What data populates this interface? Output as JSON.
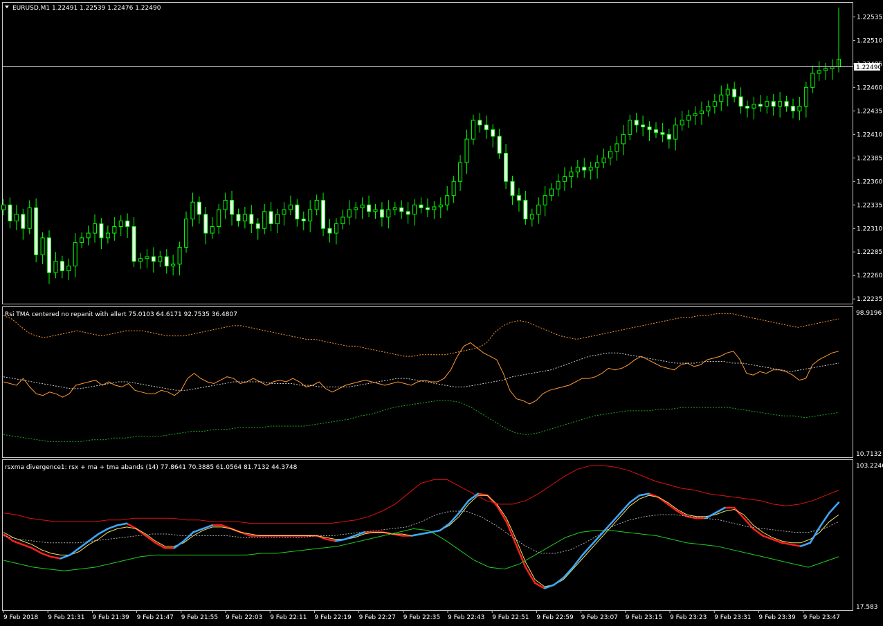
{
  "main": {
    "symbol_info": "EURUSD,M1  1.22491 1.22539 1.22476 1.22490",
    "current_price_label": "1.22490",
    "price_ticks": [
      "1.22535",
      "1.22510",
      "1.22485",
      "1.22460",
      "1.22435",
      "1.22410",
      "1.22385",
      "1.22360",
      "1.22335",
      "1.22310",
      "1.22285",
      "1.22260",
      "1.22235"
    ],
    "colors": {
      "bull": "#00ff00",
      "bull_body": "#000000",
      "bear_body": "#ffffff",
      "bg": "#000000"
    }
  },
  "rsi_panel": {
    "title": "Rsi TMA centered no repanit with allert 75.0103 64.6171 92.7535 36.4807",
    "top_label": "98.9196",
    "bottom_label": "10.7132"
  },
  "rsx_panel": {
    "title": "rsxma divergence1: rsx + ma + tma abands (14) 77.8641 70.3885 61.0564 81.7132 44.3748",
    "top_label": "103.2246",
    "bottom_label": "17.583"
  },
  "time_labels": [
    "9 Feb 2018",
    "9 Feb 21:31",
    "9 Feb 21:39",
    "9 Feb 21:47",
    "9 Feb 21:55",
    "9 Feb 22:03",
    "9 Feb 22:11",
    "9 Feb 22:19",
    "9 Feb 22:27",
    "9 Feb 22:35",
    "9 Feb 22:43",
    "9 Feb 22:51",
    "9 Feb 22:59",
    "9 Feb 23:07",
    "9 Feb 23:15",
    "9 Feb 23:23",
    "9 Feb 23:31",
    "9 Feb 23:39",
    "9 Feb 23:47"
  ],
  "chart_data": [
    {
      "type": "candlestick",
      "title": "EURUSD,M1  1.22491 1.22539 1.22476 1.22490",
      "ylim": [
        1.2223,
        1.2255
      ],
      "close": [
        1.22335,
        1.22318,
        1.22325,
        1.2231,
        1.22332,
        1.22282,
        1.223,
        1.22263,
        1.22275,
        1.22265,
        1.2227,
        1.22295,
        1.223,
        1.22305,
        1.22315,
        1.223,
        1.22305,
        1.22312,
        1.22318,
        1.22312,
        1.22275,
        1.22278,
        1.2228,
        1.22275,
        1.2228,
        1.2227,
        1.22272,
        1.2229,
        1.2232,
        1.22338,
        1.22325,
        1.22305,
        1.22312,
        1.2233,
        1.2234,
        1.22325,
        1.22318,
        1.22325,
        1.22315,
        1.2231,
        1.22328,
        1.22315,
        1.22325,
        1.2233,
        1.22335,
        1.2232,
        1.22318,
        1.2233,
        1.2234,
        1.2231,
        1.22305,
        1.22315,
        1.22322,
        1.2233,
        1.22332,
        1.22335,
        1.22328,
        1.2233,
        1.22322,
        1.2233,
        1.22332,
        1.22328,
        1.22325,
        1.22335,
        1.22332,
        1.2233,
        1.22333,
        1.22335,
        1.22345,
        1.2236,
        1.2238,
        1.22405,
        1.22425,
        1.2242,
        1.22415,
        1.22408,
        1.2239,
        1.2236,
        1.22345,
        1.2234,
        1.2232,
        1.22325,
        1.22335,
        1.22345,
        1.22352,
        1.2236,
        1.22365,
        1.2237,
        1.22375,
        1.22372,
        1.22375,
        1.2238,
        1.22385,
        1.22392,
        1.224,
        1.2241,
        1.22425,
        1.2242,
        1.22418,
        1.22415,
        1.22412,
        1.2241,
        1.22405,
        1.2242,
        1.22425,
        1.2243,
        1.22432,
        1.22435,
        1.2244,
        1.22445,
        1.22452,
        1.22458,
        1.2245,
        1.2244,
        1.22438,
        1.22442,
        1.2244,
        1.22445,
        1.2244,
        1.22445,
        1.2244,
        1.22435,
        1.2244,
        1.2246,
        1.22475,
        1.22478,
        1.2248,
        1.22482,
        1.2249
      ]
    },
    {
      "type": "line",
      "title": "Rsi TMA centered no repanit with allert 75.0103 64.6171 92.7535 36.4807",
      "ylim": [
        10.7132,
        98.9196
      ],
      "series": [
        {
          "values": [
            55,
            54,
            53,
            57,
            52,
            48,
            47,
            49,
            48,
            46,
            48,
            53,
            54,
            55,
            56,
            53,
            55,
            53,
            52,
            54,
            50,
            49,
            48,
            48,
            50,
            49,
            47,
            50,
            57,
            60,
            57,
            55,
            54,
            56,
            58,
            57,
            54,
            55,
            57,
            55,
            53,
            55,
            56,
            55,
            57,
            55,
            52,
            53,
            55,
            51,
            49,
            51,
            53,
            54,
            55,
            56,
            55,
            54,
            53,
            54,
            55,
            54,
            53,
            55,
            56,
            55,
            55,
            57,
            62,
            70,
            76,
            78,
            75,
            72,
            70,
            68,
            60,
            50,
            45,
            44,
            42,
            44,
            48,
            50,
            51,
            52,
            53,
            55,
            57,
            57,
            58,
            60,
            63,
            62,
            63,
            65,
            68,
            70,
            68,
            66,
            64,
            63,
            62,
            65,
            66,
            64,
            65,
            68,
            69,
            70,
            72,
            73,
            68,
            60,
            59,
            61,
            60,
            62,
            62,
            61,
            59,
            56,
            57,
            65,
            68,
            70,
            72,
            73
          ]
        },
        {
          "values": [
            94,
            92,
            88,
            84,
            82,
            81,
            82,
            83,
            84,
            85,
            84,
            83,
            82,
            83,
            84,
            85,
            85,
            85,
            84,
            83,
            82,
            82,
            82,
            83,
            84,
            85,
            86,
            87,
            88,
            88,
            87,
            86,
            85,
            84,
            83,
            82,
            81,
            80,
            80,
            79,
            78,
            77,
            76,
            76,
            75,
            74,
            73,
            72,
            71,
            70,
            70,
            71,
            71,
            71,
            71,
            72,
            73,
            74,
            75,
            78,
            84,
            88,
            90,
            91,
            90,
            88,
            86,
            84,
            82,
            81,
            80,
            81,
            82,
            83,
            84,
            85,
            86,
            87,
            88,
            89,
            90,
            91,
            92,
            93,
            93,
            94,
            94,
            95,
            95,
            95,
            94,
            93,
            92,
            91,
            90,
            89,
            88,
            87,
            88,
            89,
            90,
            91,
            92
          ]
        },
        {
          "values": [
            58,
            57,
            56,
            55,
            54,
            53,
            52,
            51,
            51,
            52,
            53,
            54,
            55,
            55,
            54,
            53,
            52,
            51,
            50,
            50,
            51,
            52,
            53,
            54,
            55,
            55,
            55,
            55,
            54,
            54,
            54,
            53,
            53,
            52,
            52,
            52,
            52,
            53,
            54,
            55,
            56,
            57,
            57,
            56,
            55,
            54,
            53,
            52,
            52,
            53,
            54,
            55,
            56,
            58,
            59,
            60,
            61,
            62,
            64,
            66,
            68,
            70,
            71,
            72,
            72,
            71,
            70,
            69,
            68,
            67,
            66,
            66,
            66,
            67,
            67,
            67,
            66,
            66,
            65,
            64,
            63,
            62,
            61,
            62,
            63,
            64,
            65,
            66
          ]
        },
        {
          "values": [
            24,
            23,
            22,
            21,
            20,
            20,
            20,
            20,
            21,
            21,
            22,
            22,
            23,
            23,
            23,
            24,
            25,
            26,
            26,
            27,
            27,
            28,
            28,
            28,
            29,
            29,
            29,
            29,
            30,
            31,
            32,
            33,
            35,
            36,
            38,
            40,
            41,
            42,
            43,
            44,
            44,
            43,
            40,
            36,
            32,
            28,
            25,
            24,
            25,
            27,
            29,
            31,
            33,
            35,
            36,
            37,
            38,
            38,
            38,
            39,
            39,
            40,
            40,
            40,
            40,
            40,
            39,
            38,
            37,
            36,
            35,
            35,
            34,
            35,
            36,
            37
          ]
        }
      ]
    },
    {
      "type": "line",
      "title": "rsxma divergence1: rsx + ma + tma abands (14) 77.8641 70.3885 61.0564 81.7132 44.3748",
      "ylim": [
        17.583,
        103.2246
      ],
      "series": [
        {
          "values": [
            61,
            57,
            55,
            53,
            50,
            48,
            47,
            49,
            53,
            57,
            61,
            64,
            66,
            67,
            64,
            60,
            56,
            53,
            53,
            57,
            62,
            64,
            66,
            66,
            64,
            62,
            60,
            60,
            60,
            60,
            60,
            60,
            60,
            60,
            58,
            57,
            58,
            60,
            62,
            62,
            62,
            61,
            60,
            60,
            61,
            62,
            63,
            67,
            73,
            80,
            84,
            83,
            77,
            68,
            55,
            42,
            33,
            30,
            32,
            36,
            42,
            49,
            55,
            61,
            67,
            73,
            79,
            83,
            84,
            82,
            78,
            74,
            71,
            70,
            70,
            73,
            76,
            76,
            70,
            64,
            60,
            58,
            56,
            55,
            54,
            56,
            65,
            73,
            79
          ]
        },
        {
          "values": [
            62,
            59,
            57,
            55,
            52,
            50,
            49,
            49,
            51,
            55,
            58,
            62,
            64,
            65,
            64,
            61,
            57,
            54,
            54,
            56,
            60,
            63,
            65,
            65,
            64,
            62,
            61,
            60,
            60,
            60,
            60,
            60,
            60,
            60,
            59,
            58,
            58,
            59,
            61,
            62,
            62,
            61,
            61,
            60,
            61,
            62,
            63,
            66,
            71,
            78,
            83,
            83,
            78,
            70,
            58,
            45,
            35,
            31,
            32,
            35,
            41,
            47,
            53,
            59,
            65,
            71,
            77,
            81,
            83,
            82,
            79,
            75,
            72,
            71,
            71,
            72,
            74,
            75,
            72,
            66,
            62,
            59,
            57,
            56,
            56,
            58,
            62,
            68,
            72
          ]
        },
        {
          "values": [
            73,
            72,
            70,
            69,
            68,
            68,
            68,
            68,
            69,
            69,
            70,
            70,
            70,
            70,
            69,
            69,
            68,
            68,
            68,
            67,
            67,
            67,
            67,
            67,
            67,
            67,
            68,
            69,
            71,
            74,
            78,
            84,
            90,
            92,
            92,
            88,
            84,
            80,
            78,
            78,
            80,
            84,
            89,
            94,
            98,
            100,
            100,
            99,
            97,
            94,
            91,
            89,
            87,
            86,
            84,
            83,
            82,
            81,
            80,
            78,
            77,
            78,
            80,
            83,
            86
          ]
        },
        {
          "values": [
            46,
            44,
            42,
            41,
            40,
            41,
            42,
            44,
            46,
            48,
            49,
            49,
            49,
            49,
            49,
            49,
            49,
            50,
            50,
            51,
            52,
            53,
            54,
            56,
            58,
            60,
            62,
            64,
            63,
            58,
            52,
            46,
            42,
            41,
            44,
            49,
            54,
            59,
            62,
            63,
            63,
            62,
            61,
            60,
            58,
            56,
            55,
            54,
            52,
            50,
            48,
            46,
            44,
            42,
            45,
            48
          ]
        },
        {
          "values": [
            60,
            58,
            57,
            56,
            56,
            56,
            57,
            58,
            59,
            60,
            61,
            61,
            60,
            60,
            60,
            60,
            59,
            59,
            59,
            59,
            59,
            60,
            60,
            61,
            62,
            63,
            64,
            65,
            68,
            72,
            74,
            74,
            71,
            66,
            60,
            54,
            50,
            50,
            52,
            56,
            61,
            66,
            69,
            71,
            72,
            72,
            71,
            70,
            69,
            67,
            65,
            64,
            63,
            62,
            62,
            64,
            68
          ]
        }
      ]
    }
  ]
}
